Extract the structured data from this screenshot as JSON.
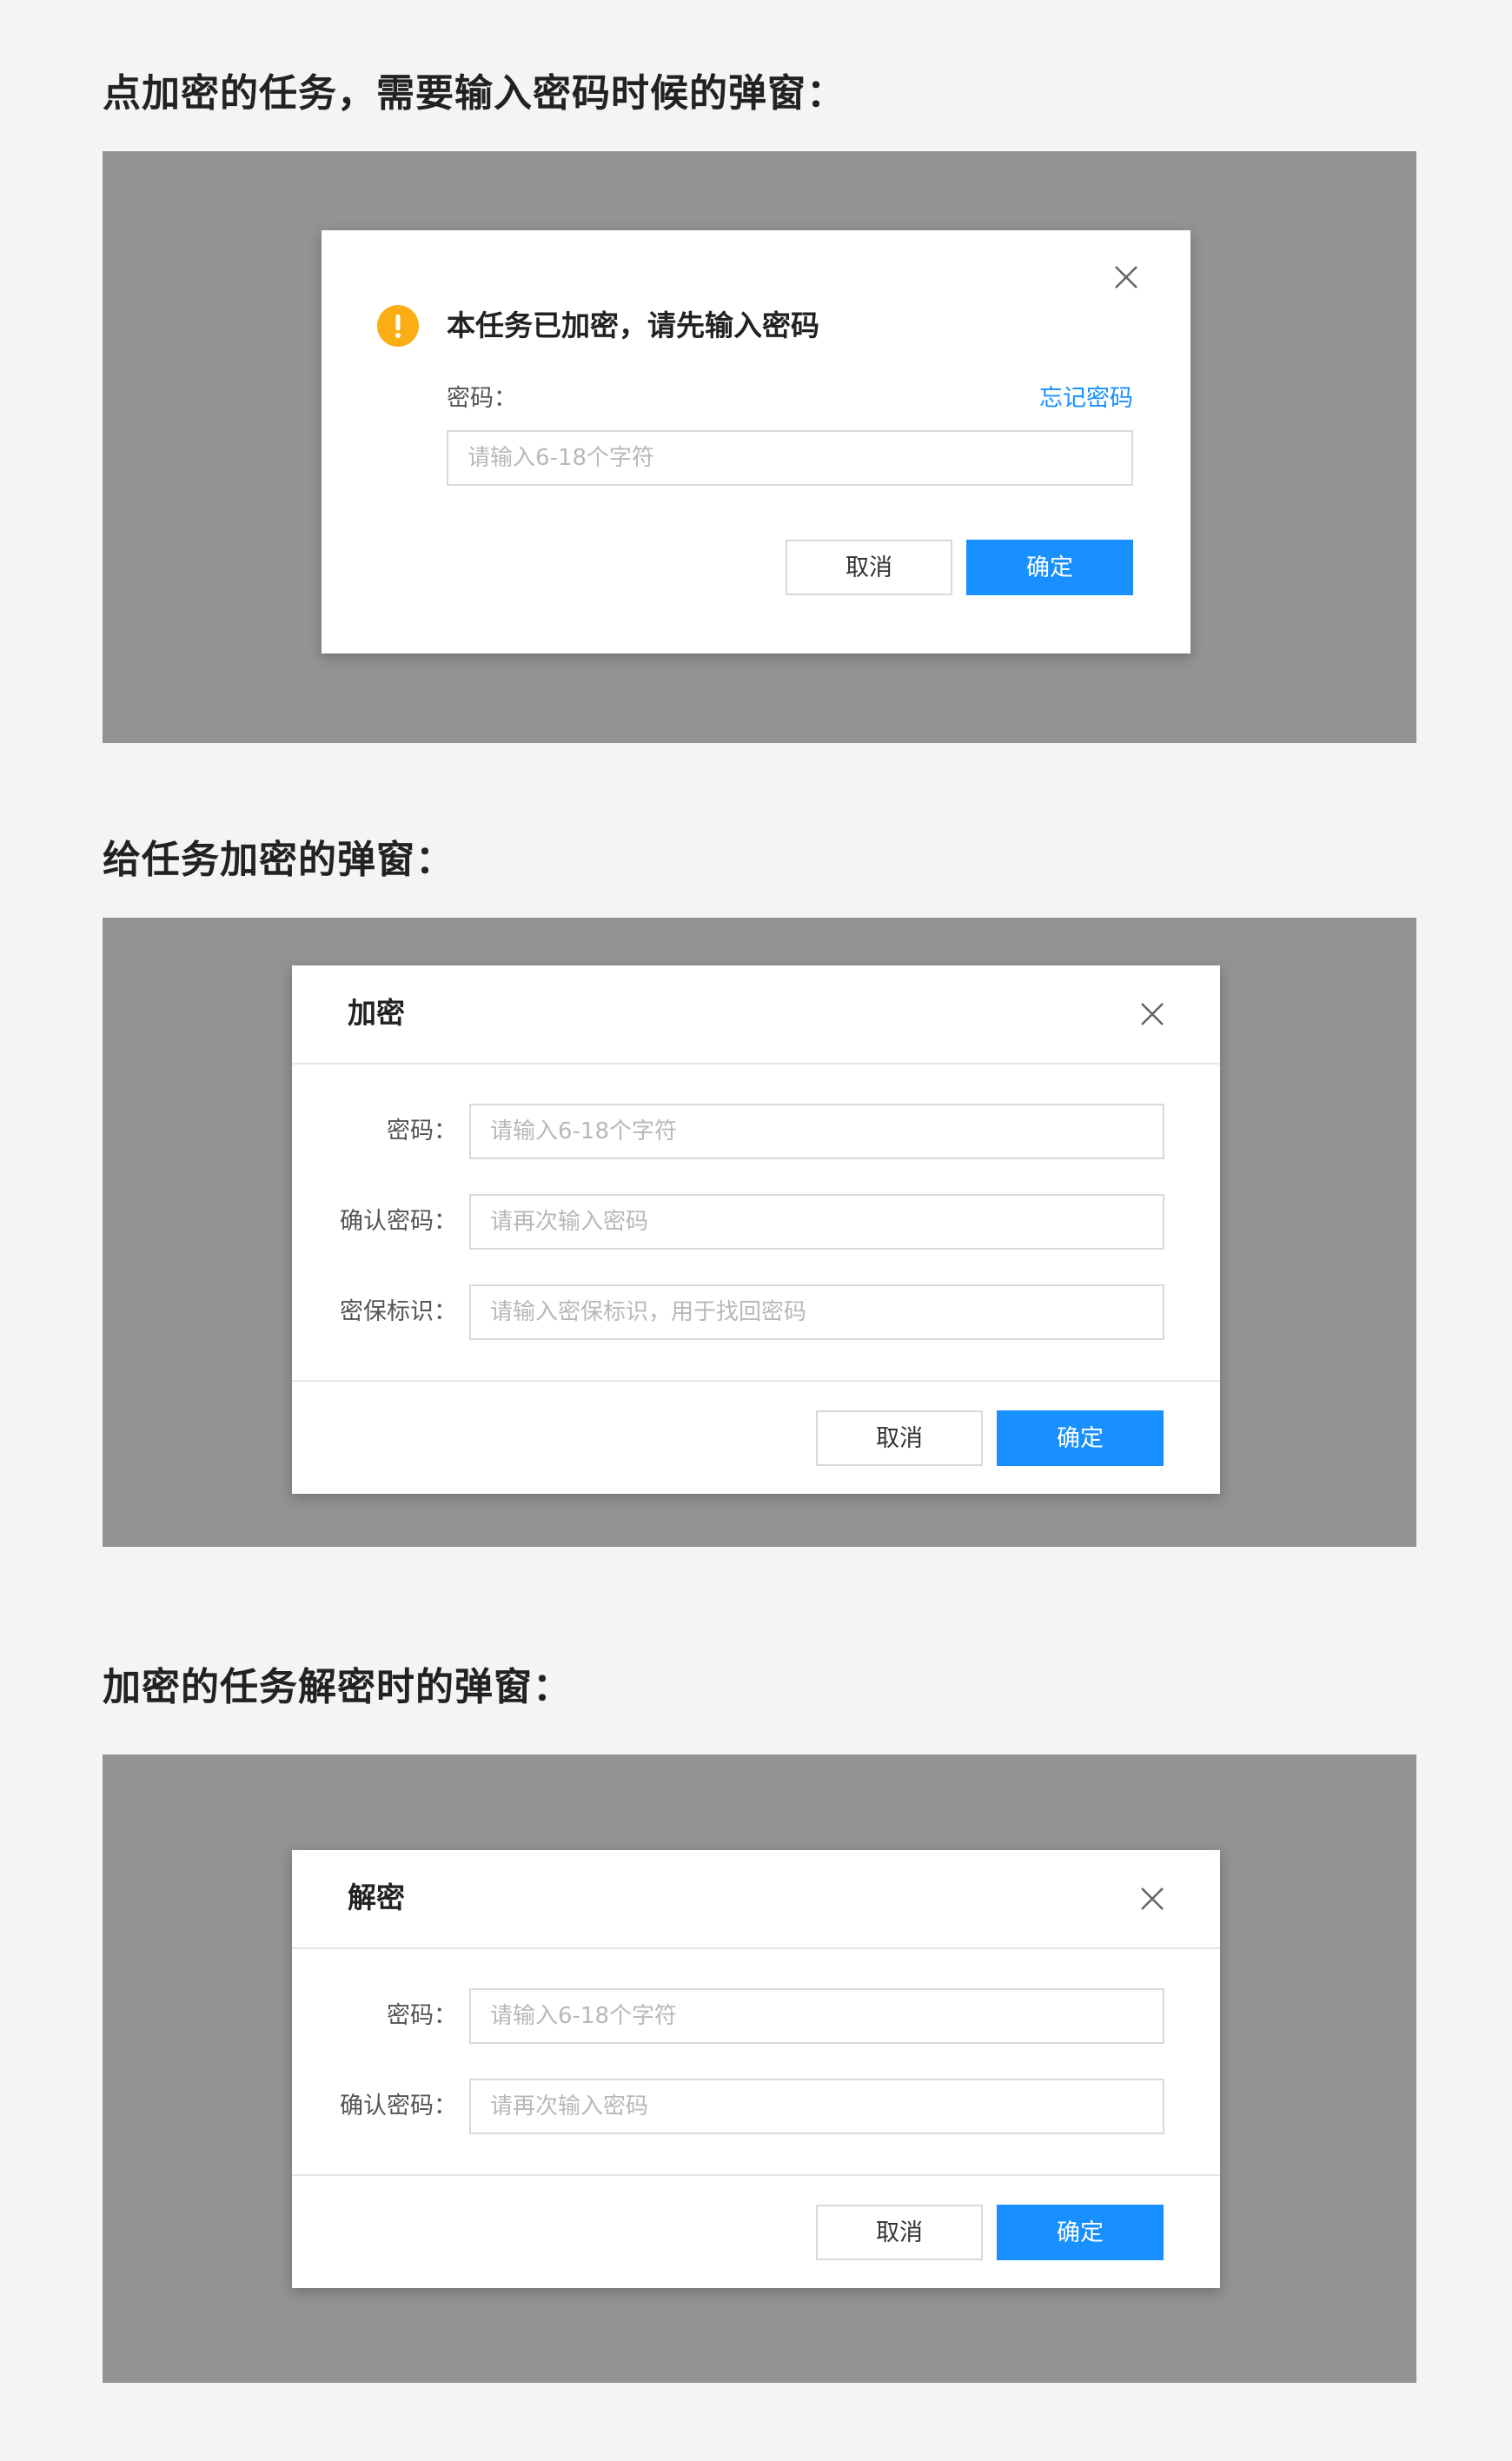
{
  "sections": [
    {
      "title": "点加密的任务，需要输入密码时候的弹窗：",
      "dialog": {
        "message": "本任务已加密，请先输入密码",
        "password_label": "密码：",
        "forgot_link": "忘记密码",
        "password_placeholder": "请输入6-18个字符",
        "cancel_label": "取消",
        "confirm_label": "确定"
      }
    },
    {
      "title": "给任务加密的弹窗：",
      "dialog": {
        "title": "加密",
        "fields": [
          {
            "label": "密码：",
            "placeholder": "请输入6-18个字符"
          },
          {
            "label": "确认密码：",
            "placeholder": "请再次输入密码"
          },
          {
            "label": "密保标识：",
            "placeholder": "请输入密保标识，用于找回密码"
          }
        ],
        "cancel_label": "取消",
        "confirm_label": "确定"
      }
    },
    {
      "title": "加密的任务解密时的弹窗：",
      "dialog": {
        "title": "解密",
        "fields": [
          {
            "label": "密码：",
            "placeholder": "请输入6-18个字符"
          },
          {
            "label": "确认密码：",
            "placeholder": "请再次输入密码"
          }
        ],
        "cancel_label": "取消",
        "confirm_label": "确定"
      }
    }
  ],
  "icons": {
    "warning": "exclamation-circle",
    "close": "close-x"
  },
  "colors": {
    "primary": "#1890ff",
    "warning": "#faad14",
    "backdrop": "#939393",
    "page_background": "#f4f4f4"
  }
}
